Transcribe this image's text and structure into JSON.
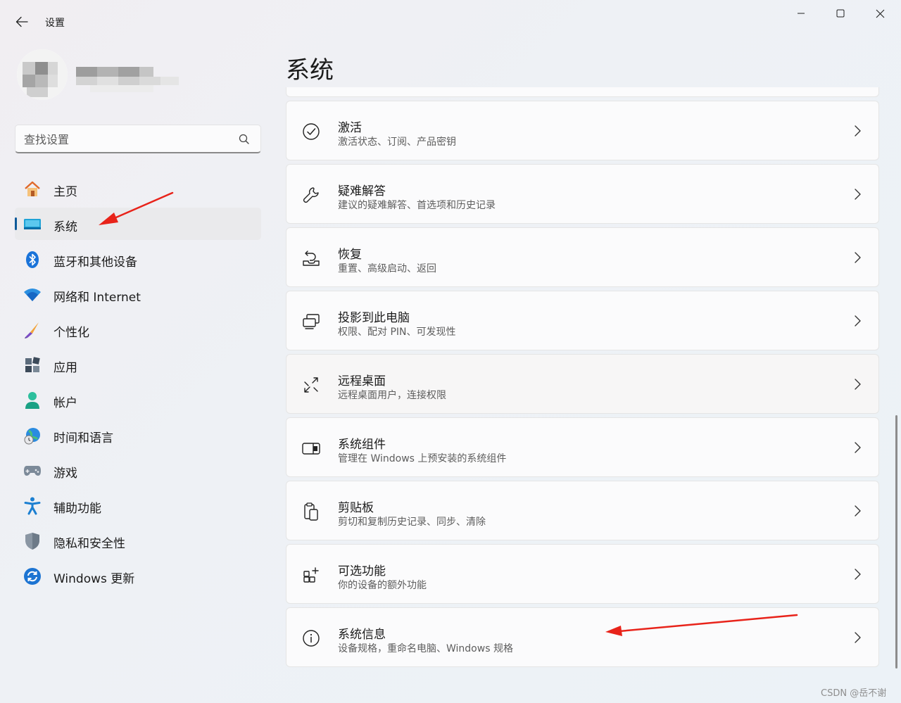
{
  "app": {
    "title": "设置"
  },
  "search": {
    "placeholder": "查找设置"
  },
  "sidebar": {
    "items": [
      {
        "label": "主页",
        "icon": "home-icon"
      },
      {
        "label": "系统",
        "icon": "system-icon",
        "selected": true
      },
      {
        "label": "蓝牙和其他设备",
        "icon": "bluetooth-icon"
      },
      {
        "label": "网络和 Internet",
        "icon": "wifi-icon"
      },
      {
        "label": "个性化",
        "icon": "brush-icon"
      },
      {
        "label": "应用",
        "icon": "apps-icon"
      },
      {
        "label": "帐户",
        "icon": "account-icon"
      },
      {
        "label": "时间和语言",
        "icon": "globe-clock-icon"
      },
      {
        "label": "游戏",
        "icon": "gamepad-icon"
      },
      {
        "label": "辅助功能",
        "icon": "accessibility-icon"
      },
      {
        "label": "隐私和安全性",
        "icon": "shield-icon"
      },
      {
        "label": "Windows 更新",
        "icon": "update-icon"
      }
    ]
  },
  "main": {
    "title": "系统",
    "cards": [
      {
        "title": "激活",
        "desc": "激活状态、订阅、产品密钥",
        "icon": "check-circle-icon"
      },
      {
        "title": "疑难解答",
        "desc": "建议的疑难解答、首选项和历史记录",
        "icon": "wrench-icon"
      },
      {
        "title": "恢复",
        "desc": "重置、高级启动、返回",
        "icon": "recovery-icon"
      },
      {
        "title": "投影到此电脑",
        "desc": "权限、配对 PIN、可发现性",
        "icon": "project-icon"
      },
      {
        "title": "远程桌面",
        "desc": "远程桌面用户，连接权限",
        "icon": "remote-desktop-icon"
      },
      {
        "title": "系统组件",
        "desc": "管理在 Windows 上预安装的系统组件",
        "icon": "components-icon"
      },
      {
        "title": "剪贴板",
        "desc": "剪切和复制历史记录、同步、清除",
        "icon": "clipboard-icon"
      },
      {
        "title": "可选功能",
        "desc": "你的设备的额外功能",
        "icon": "optional-features-icon"
      },
      {
        "title": "系统信息",
        "desc": "设备规格，重命名电脑、Windows 规格",
        "icon": "info-icon"
      }
    ]
  },
  "watermark": "CSDN @岳不谢",
  "colors": {
    "accent": "#0e5a9a",
    "annotation_arrow": "#e8231a"
  }
}
